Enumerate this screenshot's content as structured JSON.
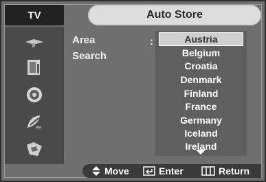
{
  "header": {
    "tab_label": "TV",
    "title": "Auto Store"
  },
  "sidebar": {
    "icons": [
      "antenna-icon",
      "picture-icon",
      "speaker-icon",
      "satellite-dish-icon",
      "setup-icon"
    ]
  },
  "fields": {
    "area_label": "Area",
    "search_label": "Search",
    "separator": ":"
  },
  "area_list": {
    "selected": "Austria",
    "items": [
      "Austria",
      "Belgium",
      "Croatia",
      "Denmark",
      "Finland",
      "France",
      "Germany",
      "Iceland",
      "Ireland"
    ],
    "more_indicator_icon": "triangle-down-icon"
  },
  "footer": {
    "move_label": "Move",
    "enter_label": "Enter",
    "return_label": "Return"
  },
  "colors": {
    "background": "#6f6f6f",
    "header_tab": "#222222",
    "title_pill": "#dcdcdc",
    "selected_item": "#cfcfcf"
  }
}
